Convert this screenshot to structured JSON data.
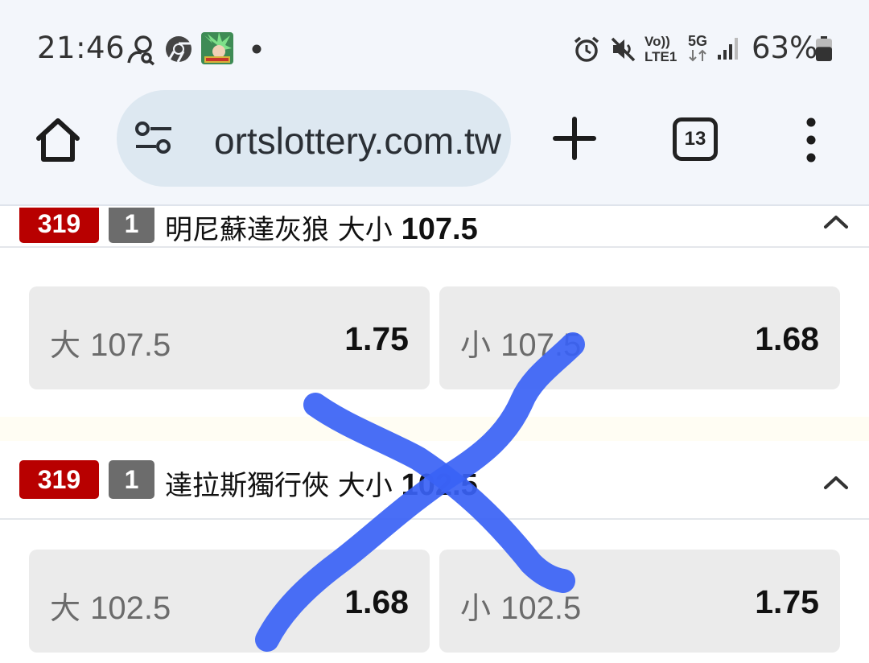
{
  "status_bar": {
    "time": "21:46",
    "left_icons": [
      "people-search-icon",
      "chrome-icon",
      "game-app-icon",
      "notification-dot-icon"
    ],
    "right_icons": [
      "alarm-icon",
      "mute-icon",
      "volte-icon",
      "5g-icon",
      "signal-icon"
    ],
    "volte_label_top": "Vo))",
    "volte_label_bottom": "LTE1",
    "network_label": "5G",
    "battery_percent": "63%",
    "battery_level": 0.63
  },
  "browser": {
    "url": "ortslottery.com.tw",
    "tab_count": "13",
    "icons": [
      "home-icon",
      "site-settings-icon",
      "plus-icon",
      "tab-switcher-icon",
      "more-vert-icon"
    ]
  },
  "markets": [
    {
      "code": "319",
      "period": "1",
      "team": "明尼蘇達灰狼",
      "type": "大小",
      "line": "107.5",
      "options": [
        {
          "side": "大",
          "line": "107.5",
          "odds": "1.75"
        },
        {
          "side": "小",
          "line": "107.5",
          "odds": "1.68"
        }
      ]
    },
    {
      "code": "319",
      "period": "1",
      "team": "達拉斯獨行俠",
      "type": "大小",
      "line": "102.5",
      "options": [
        {
          "side": "大",
          "line": "102.5",
          "odds": "1.68"
        },
        {
          "side": "小",
          "line": "102.5",
          "odds": "1.75"
        }
      ]
    }
  ],
  "annotation": {
    "mark": "X",
    "color": "#3a62f5"
  }
}
